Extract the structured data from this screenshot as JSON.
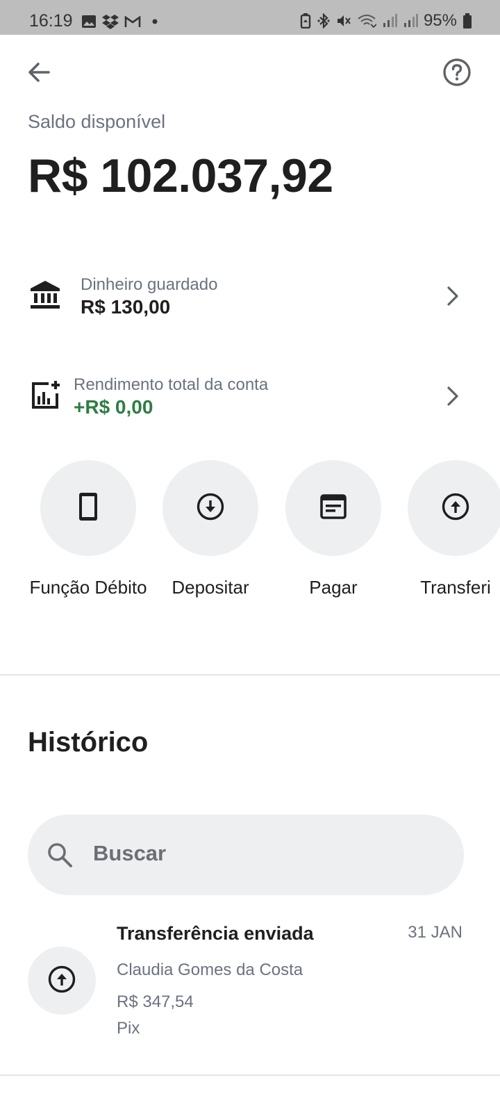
{
  "status_bar": {
    "time": "16:19",
    "battery": "95%",
    "left_icons": [
      "image-icon",
      "dropbox-icon",
      "gmail-icon",
      "dot-icon"
    ],
    "right_icons": [
      "battery-saver-icon",
      "bluetooth-icon",
      "mute-icon",
      "wifi-icon",
      "signal-icon",
      "signal-icon",
      "battery-icon"
    ]
  },
  "header": {
    "back_icon": "arrow-left-icon",
    "help_icon": "help-circle-icon"
  },
  "balance": {
    "label": "Saldo disponível",
    "value": "R$ 102.037,92"
  },
  "rows": [
    {
      "icon": "bank-icon",
      "label": "Dinheiro guardado",
      "value": "R$ 130,00"
    },
    {
      "icon": "chart-add-icon",
      "label": "Rendimento total da conta",
      "value": "+R$ 0,00",
      "value_color": "#2e7d43"
    }
  ],
  "actions": [
    {
      "icon": "phone-icon",
      "label": "Função Débito"
    },
    {
      "icon": "arrow-down-circle-icon",
      "label": "Depositar"
    },
    {
      "icon": "receipt-icon",
      "label": "Pagar"
    },
    {
      "icon": "arrow-up-circle-icon",
      "label": "Transferi"
    }
  ],
  "history": {
    "title": "Histórico",
    "search_placeholder": "Buscar",
    "transactions": [
      {
        "icon": "arrow-up-circle-icon",
        "title": "Transferência enviada",
        "date": "31 JAN",
        "name": "Claudia Gomes da Costa",
        "amount": "R$ 347,54",
        "method": "Pix"
      }
    ]
  },
  "colors": {
    "status_bar_bg": "#bdbdbd",
    "accent_green": "#2e7d43",
    "muted_text": "#6b7280",
    "chip_bg": "#eeeff1"
  }
}
